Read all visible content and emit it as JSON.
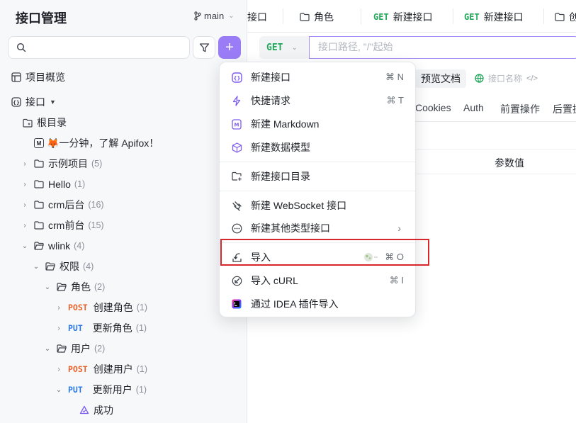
{
  "sidebar": {
    "title": "接口管理",
    "branch": "main",
    "nav": {
      "overview": "项目概览",
      "apis": "接口"
    },
    "tree": {
      "root": "根目录",
      "doc": "🦊一分钟，了解 Apifox！",
      "folders": [
        {
          "label": "示例项目",
          "count": "(5)"
        },
        {
          "label": "Hello",
          "count": "(1)"
        },
        {
          "label": "crm后台",
          "count": "(16)"
        },
        {
          "label": "crm前台",
          "count": "(15)"
        },
        {
          "label": "wlink",
          "count": "(4)"
        }
      ],
      "permission": {
        "label": "权限",
        "count": "(4)"
      },
      "role": {
        "label": "角色",
        "count": "(2)"
      },
      "role_items": [
        {
          "method": "POST",
          "label": "创建角色",
          "count": "(1)"
        },
        {
          "method": "PUT",
          "label": "更新角色",
          "count": "(1)"
        }
      ],
      "user": {
        "label": "用户",
        "count": "(2)"
      },
      "user_items": [
        {
          "method": "POST",
          "label": "创建用户",
          "count": "(1)"
        },
        {
          "method": "PUT",
          "label": "更新用户",
          "count": "(1)"
        }
      ],
      "success": "成功"
    }
  },
  "tabs": [
    {
      "method": "",
      "label": "接口"
    },
    {
      "method": "",
      "label": "角色"
    },
    {
      "method": "GET",
      "label": "新建接口"
    },
    {
      "method": "GET",
      "label": "新建接口"
    },
    {
      "method": "",
      "label": "创"
    }
  ],
  "request": {
    "method": "GET",
    "url_placeholder": "接口路径, \"/\"起始",
    "preview_label": "预览文档",
    "name_placeholder": "接口名称"
  },
  "subtabs": [
    "Cookies",
    "Auth",
    "前置操作",
    "后置操"
  ],
  "params": {
    "value_header": "参数值"
  },
  "menu": {
    "items": [
      {
        "label": "新建接口",
        "shortcut": "⌘ N",
        "icon": "api-icon"
      },
      {
        "label": "快捷请求",
        "shortcut": "⌘ T",
        "icon": "lightning-icon"
      },
      {
        "label": "新建 Markdown",
        "shortcut": "",
        "icon": "markdown-icon"
      },
      {
        "label": "新建数据模型",
        "shortcut": "",
        "icon": "cube-icon"
      },
      {
        "label": "新建接口目录",
        "shortcut": "",
        "icon": "folder-add-icon"
      },
      {
        "label": "新建 WebSocket 接口",
        "shortcut": "",
        "icon": "websocket-icon"
      },
      {
        "label": "新建其他类型接口",
        "shortcut": "",
        "icon": "more-icon"
      },
      {
        "label": "导入",
        "shortcut": "⌘ O",
        "icon": "import-icon"
      },
      {
        "label": "导入 cURL",
        "shortcut": "⌘ I",
        "icon": "curl-icon"
      },
      {
        "label": "通过 IDEA 插件导入",
        "shortcut": "",
        "icon": "idea-icon"
      }
    ],
    "submenu_arrow": "›"
  },
  "colors": {
    "accent": "#9b7cf7",
    "get": "#22a65a",
    "post": "#e8632b",
    "put": "#2e78e6",
    "highlight": "#d8262d"
  }
}
